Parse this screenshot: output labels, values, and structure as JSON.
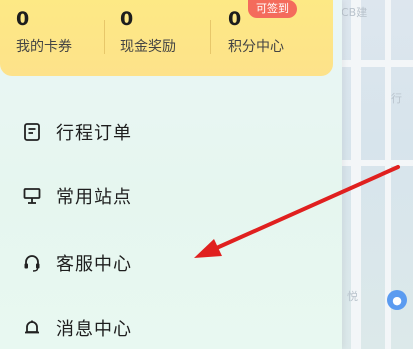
{
  "stats": [
    {
      "value": "0",
      "label": "我的卡券"
    },
    {
      "value": "0",
      "label": "现金奖励"
    },
    {
      "value": "0",
      "label": "积分中心"
    }
  ],
  "badge": "可签到",
  "menu": [
    {
      "label": "行程订单",
      "icon": "order-list-icon"
    },
    {
      "label": "常用站点",
      "icon": "station-sign-icon"
    },
    {
      "label": "客服中心",
      "icon": "headset-icon"
    },
    {
      "label": "消息中心",
      "icon": "bell-icon"
    }
  ],
  "map": {
    "label_top": "CB建",
    "label_mid": "行",
    "label_low": "悦"
  },
  "colors": {
    "card": "#fde985",
    "badge": "#f46b5c",
    "annotation_arrow": "#e0201f"
  }
}
